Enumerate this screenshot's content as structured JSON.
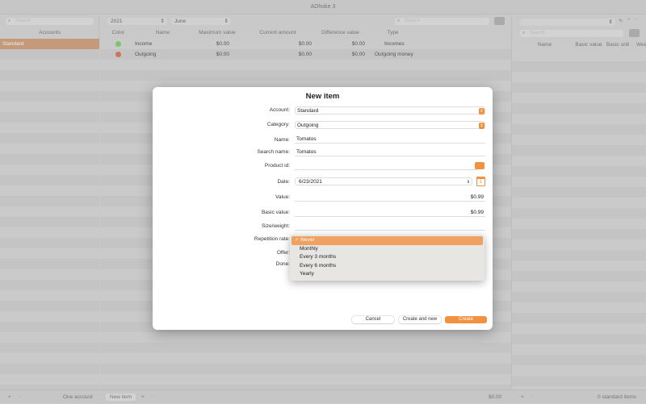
{
  "app_title": "ADhoke 3",
  "colors": {
    "accent": "#f0923f",
    "income": "#7dc46a",
    "outgoing": "#d0705f"
  },
  "sidebar": {
    "search_placeholder": "Search",
    "header": "Accounts",
    "items": [
      "Standard"
    ],
    "footer": "One account"
  },
  "main": {
    "year": "2021",
    "month": "June",
    "search_placeholder": "Search",
    "columns": [
      "Color",
      "Name",
      "Maximum value",
      "Current amount",
      "Difference value",
      "Type"
    ],
    "rows": [
      {
        "color": "green",
        "name": "Income",
        "max": "$0.00",
        "current": "$0.00",
        "diff": "$0.00",
        "type": "Incomes"
      },
      {
        "color": "red",
        "name": "Outgoing",
        "max": "$0.00",
        "current": "$0.00",
        "diff": "$0.00",
        "type": "Outgoing money"
      }
    ],
    "footer_button": "New item",
    "footer_total": "$0.00"
  },
  "right": {
    "search_placeholder": "Search",
    "columns": [
      "Name",
      "Basic value",
      "Basic unit",
      "Weig"
    ],
    "footer": "0 standard items"
  },
  "dialog": {
    "title": "New item",
    "labels": {
      "account": "Account:",
      "category": "Category:",
      "name": "Name:",
      "search_name": "Search name:",
      "product_id": "Product id:",
      "date": "Date:",
      "value": "Value:",
      "basic_value": "Basic value:",
      "size": "Size/weight:",
      "repetition": "Repetition rate:",
      "offer": "Offer:",
      "done": "Done:"
    },
    "values": {
      "account": "Standard",
      "category": "Outgoing",
      "name": "Tomatos",
      "search_name": "Tomatos",
      "product_id": "",
      "date": "6/23/2021",
      "value": "$0.99",
      "basic_value": "$0.99",
      "size": "",
      "calendar_day": "1"
    },
    "repetition_options": [
      "Never",
      "Monthly",
      "Every 3 months",
      "Every 6 months",
      "Yearly"
    ],
    "repetition_selected": "Never",
    "buttons": {
      "cancel": "Cancel",
      "create_new": "Create and new",
      "create": "Create"
    }
  }
}
